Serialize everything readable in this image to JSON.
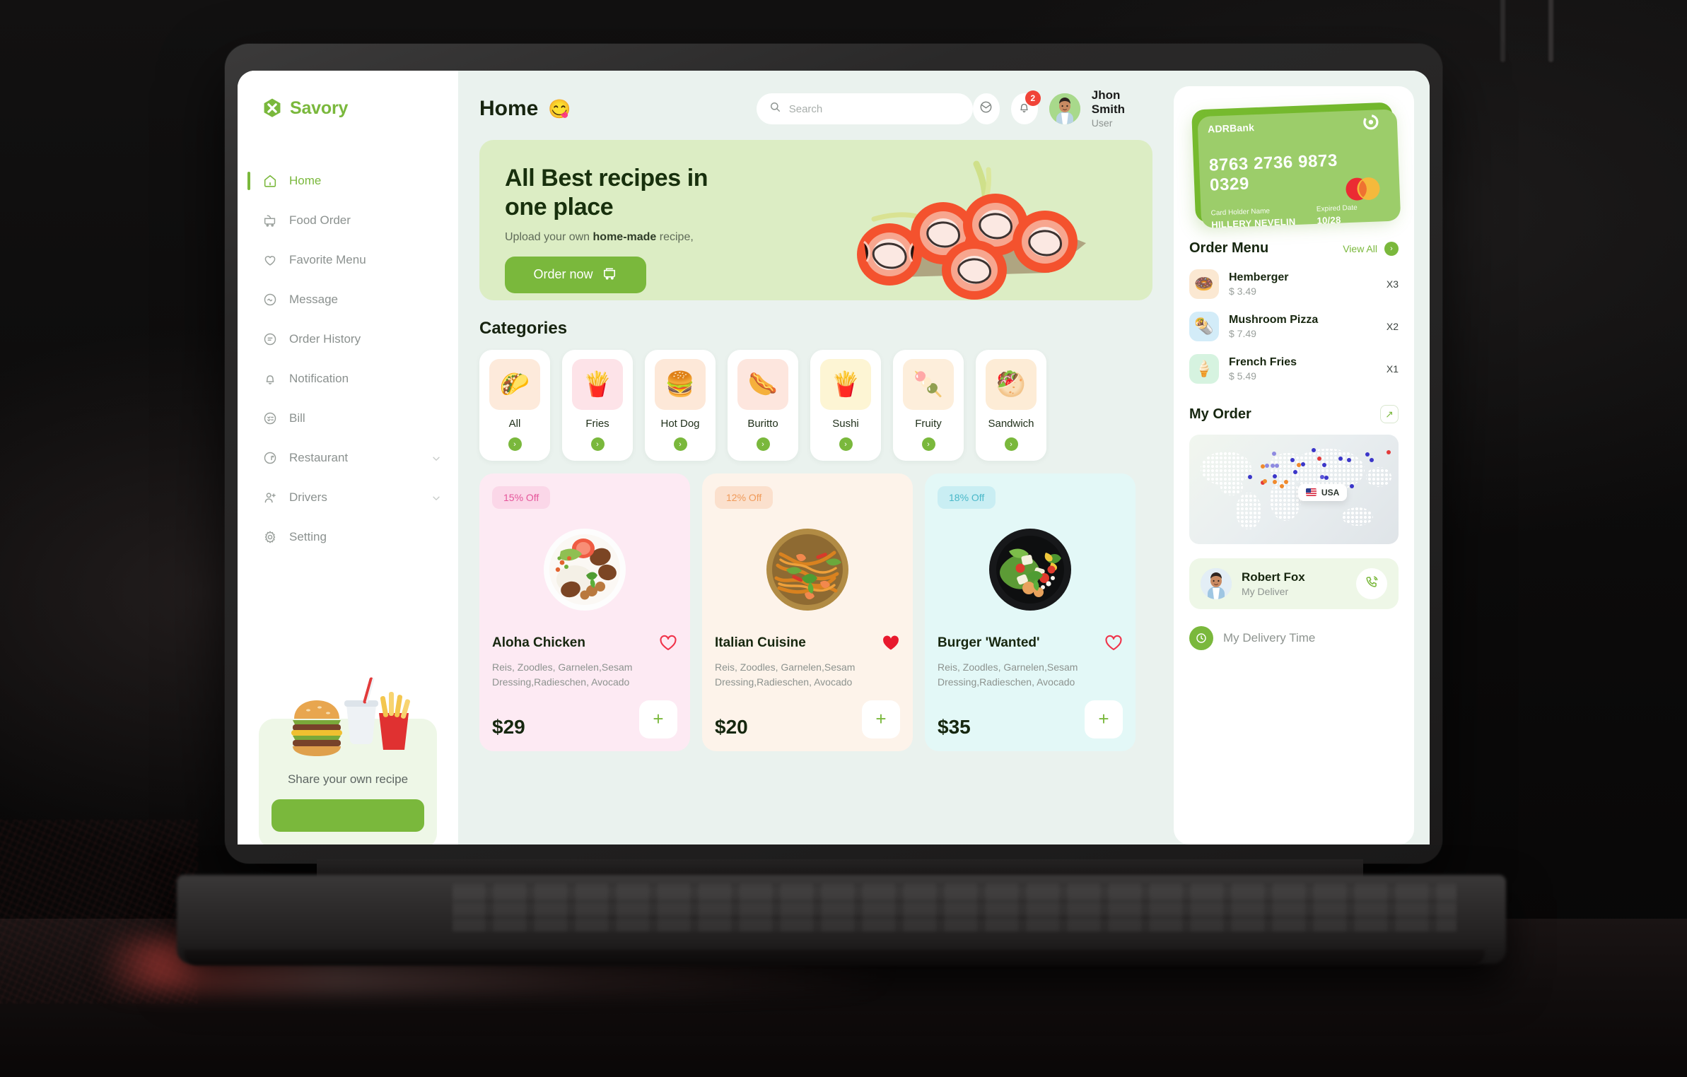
{
  "brand": {
    "name": "Savory",
    "accent": "#7ab83c",
    "icon": "hexagon-x-logo"
  },
  "sidebar": {
    "items": [
      {
        "label": "Home",
        "icon": "home-icon",
        "active": true,
        "expandable": false
      },
      {
        "label": "Food Order",
        "icon": "food-cart-icon",
        "active": false,
        "expandable": false
      },
      {
        "label": "Favorite Menu",
        "icon": "heart-icon",
        "active": false,
        "expandable": false
      },
      {
        "label": "Message",
        "icon": "message-icon",
        "active": false,
        "expandable": false
      },
      {
        "label": "Order History",
        "icon": "history-icon",
        "active": false,
        "expandable": false
      },
      {
        "label": "Notification",
        "icon": "bell-icon",
        "active": false,
        "expandable": false
      },
      {
        "label": "Bill",
        "icon": "bill-icon",
        "active": false,
        "expandable": false
      },
      {
        "label": "Restaurant",
        "icon": "restaurant-icon",
        "active": false,
        "expandable": true
      },
      {
        "label": "Drivers",
        "icon": "user-add-icon",
        "active": false,
        "expandable": true
      },
      {
        "label": "Setting",
        "icon": "gear-icon",
        "active": false,
        "expandable": false
      }
    ],
    "promo": {
      "text": "Share your own recipe",
      "image": "burger-fries-drink-image",
      "button_label": ""
    }
  },
  "header": {
    "title": "Home",
    "emoji": "😋",
    "search_placeholder": "Search",
    "search_value": "",
    "mail_icon": "mail-icon",
    "bell_icon": "bell-icon",
    "notification_count": "2",
    "user_name": "Jhon Smith",
    "user_role": "User"
  },
  "hero": {
    "title": "All Best recipes in one place",
    "subtitle_pre": "Upload your own ",
    "subtitle_bold": "home-made",
    "subtitle_post": " recipe,",
    "button_label": "Order now",
    "button_icon": "cart-icon",
    "image": "sushi-salmon-rolls-image",
    "bg": "#dcedc4"
  },
  "categories": {
    "title": "Categories",
    "items": [
      {
        "label": "All",
        "emoji": "🌮",
        "bg": "#fdeadb"
      },
      {
        "label": "Fries",
        "emoji": "🍟",
        "bg": "#fde3e8"
      },
      {
        "label": "Hot Dog",
        "emoji": "🍔",
        "bg": "#fde8d8"
      },
      {
        "label": "Buritto",
        "emoji": "🌭",
        "bg": "#fde6de"
      },
      {
        "label": "Sushi",
        "emoji": "🍟",
        "bg": "#fdf5d4"
      },
      {
        "label": "Fruity",
        "emoji": "🍡",
        "bg": "#fdeedb"
      },
      {
        "label": "Sandwich",
        "emoji": "🥙",
        "bg": "#fdecd6"
      }
    ]
  },
  "foods": [
    {
      "discount": "15% Off",
      "discount_bg": "#fbd7e8",
      "discount_color": "#e5559a",
      "card_bg": "#fdeaf3",
      "name": "Aloha Chicken",
      "description": "Reis, Zoodles, Garnelen,Sesam Dressing,Radieschen, Avocado",
      "price": "$29",
      "favorited": false,
      "image": "plate-meat-rice-image",
      "add_label": "+"
    },
    {
      "discount": "12% Off",
      "discount_bg": "#fbe0cd",
      "discount_color": "#f09a59",
      "card_bg": "#fdf3ea",
      "name": "Italian Cuisine",
      "description": "Reis, Zoodles, Garnelen,Sesam Dressing,Radieschen, Avocado",
      "price": "$20",
      "favorited": true,
      "image": "noodle-bowl-image",
      "add_label": "+"
    },
    {
      "discount": "18% Off",
      "discount_bg": "#c9eef3",
      "discount_color": "#49b8c9",
      "card_bg": "#e3f8f7",
      "name": "Burger 'Wanted'",
      "description": "Reis, Zoodles, Garnelen,Sesam Dressing,Radieschen, Avocado",
      "price": "$35",
      "favorited": false,
      "image": "salad-bowl-image",
      "add_label": "+"
    }
  ],
  "wallet": {
    "bank": "ADRBank",
    "number": "8763 2736 9873 0329",
    "holder_label": "Card Holder Name",
    "holder_name": "HILLERY NEVELIN",
    "expiry_label": "Expired Date",
    "expiry": "10/28",
    "network": "mastercard-logo",
    "bg": "#72b82f"
  },
  "order_menu": {
    "title": "Order Menu",
    "view_all": "View All",
    "items": [
      {
        "name": "Hemberger",
        "price": "$ 3.49",
        "qty": "X3",
        "emoji": "🍩",
        "bg": "#fbe8d2"
      },
      {
        "name": "Mushroom Pizza",
        "price": "$ 7.49",
        "qty": "X2",
        "emoji": "🌯",
        "bg": "#d3ecf8"
      },
      {
        "name": "French Fries",
        "price": "$ 5.49",
        "qty": "X1",
        "emoji": "🍦",
        "bg": "#d6f3e0"
      }
    ]
  },
  "my_order": {
    "title": "My Order",
    "expand_icon": "arrow-up-right-icon",
    "map_tooltip": "USA",
    "map_flag": "us-flag-icon"
  },
  "delivery": {
    "name": "Robert Fox",
    "role": "My Deliver",
    "call_icon": "phone-icon",
    "time_label": "My Delivery Time",
    "time_icon": "clock-icon"
  }
}
